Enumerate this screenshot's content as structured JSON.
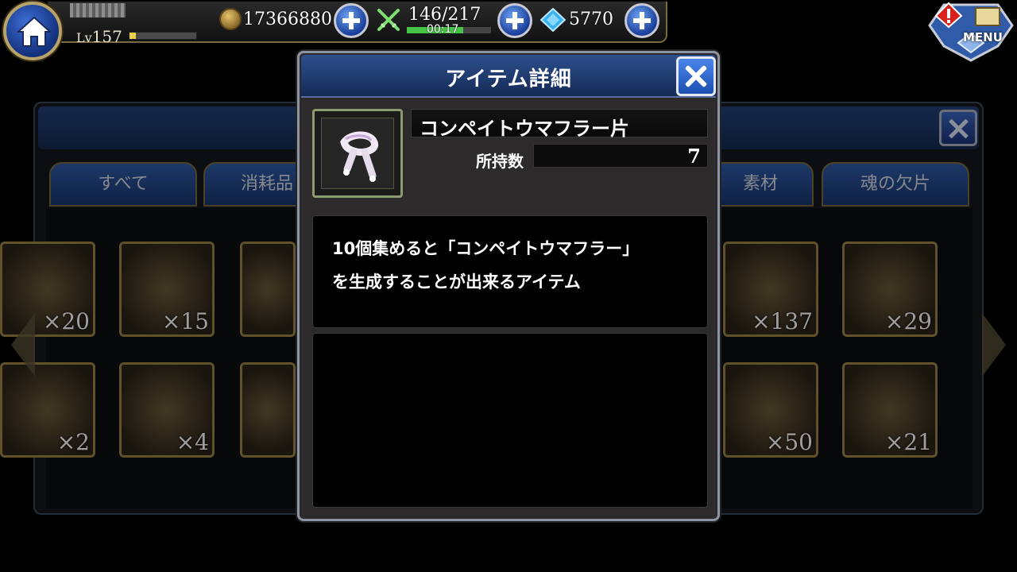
{
  "hud": {
    "level_prefix": "Lv",
    "level": "157",
    "exp_fraction": 0.1,
    "gold": "17366880",
    "stamina": "146/217",
    "stamina_fraction": 0.67,
    "stamina_timer": "00:17",
    "gems": "5770",
    "menu_label": "MENU"
  },
  "background": {
    "tabs": [
      {
        "label": "すべて"
      },
      {
        "label": "消耗品"
      },
      {
        "label": "素材"
      },
      {
        "label": "魂の欠片"
      }
    ],
    "slots": [
      {
        "count": "×20"
      },
      {
        "count": "×15"
      },
      {
        "count": "×137"
      },
      {
        "count": "×29"
      },
      {
        "count": "×2"
      },
      {
        "count": "×4"
      },
      {
        "count": "×50"
      },
      {
        "count": "×21"
      }
    ]
  },
  "modal": {
    "title": "アイテム詳細",
    "item_name": "コンペイトウマフラー片",
    "owned_label": "所持数",
    "owned_count": "7",
    "description": "10個集めると「コンペイトウマフラー」\nを生成することが出来るアイテム"
  },
  "colors": {
    "modal_title_bar": "#2e4f8c",
    "close_button": "#4a86ea",
    "gold_border": "#9c8446"
  }
}
